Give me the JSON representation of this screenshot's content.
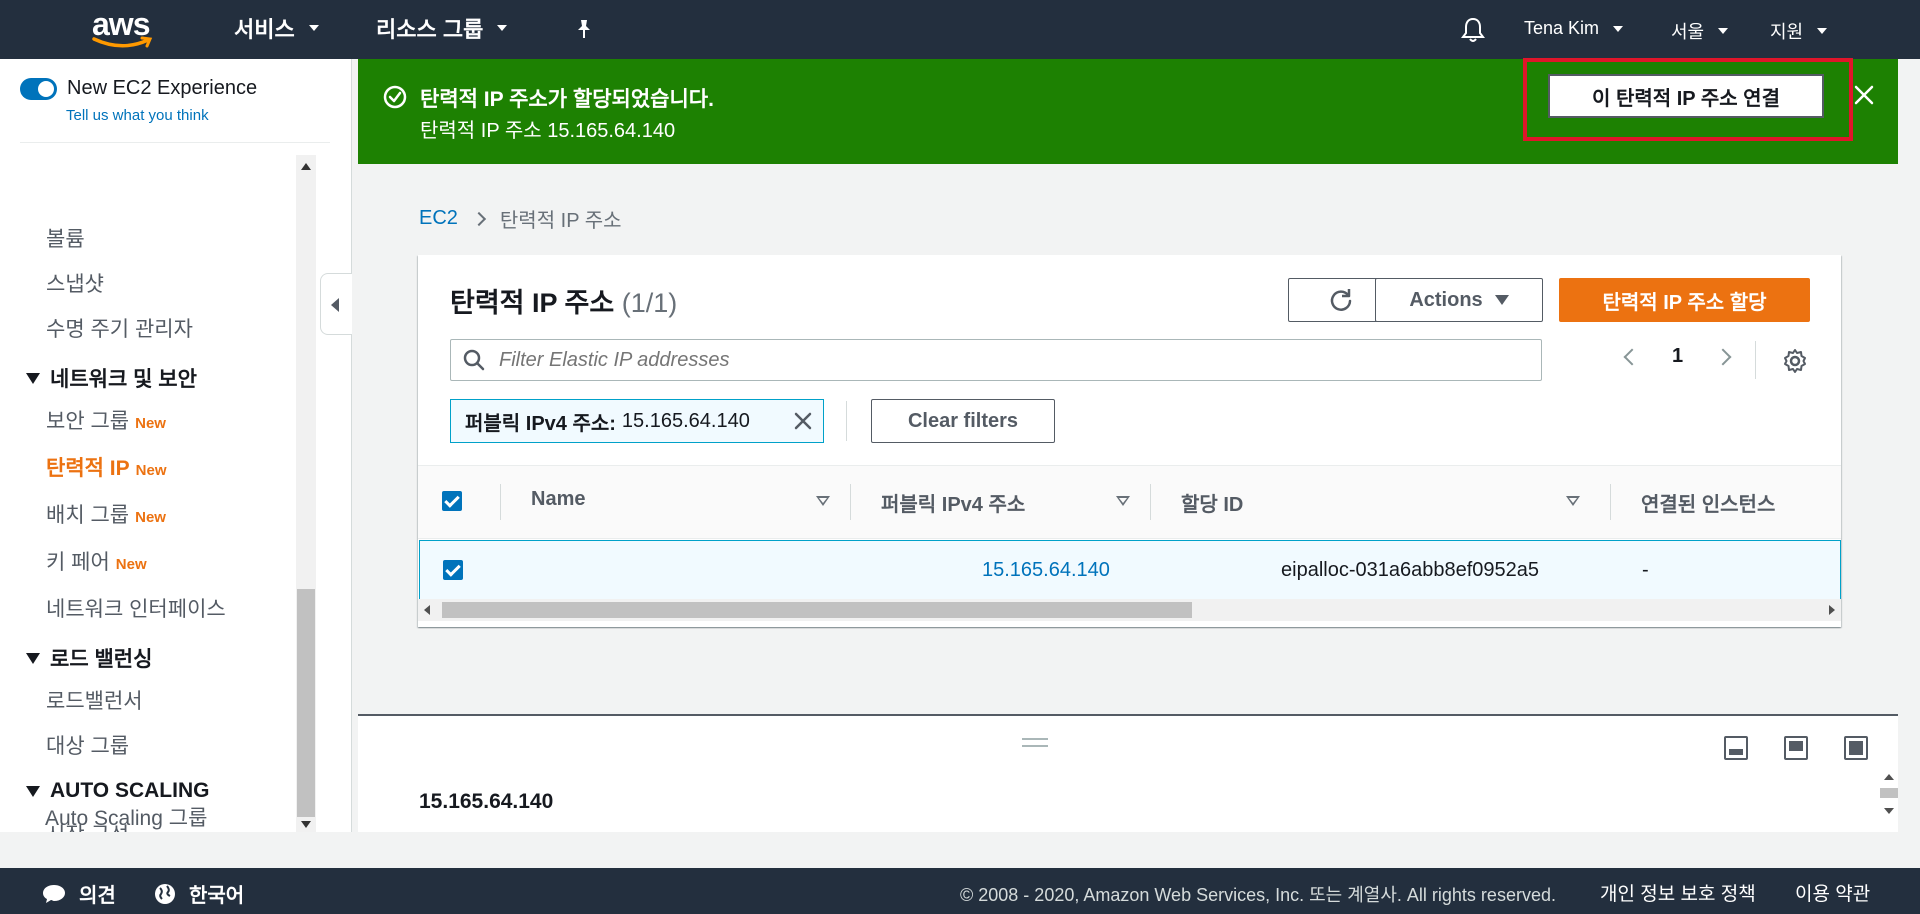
{
  "nav": {
    "logo": "aws",
    "services": "서비스",
    "resource_groups": "리소스 그룹",
    "user": "Tena Kim",
    "region": "서울",
    "support": "지원",
    "icons": [
      "bell-icon",
      "pin-icon"
    ]
  },
  "sidebar": {
    "toggle_label": "New EC2 Experience",
    "toggle_on": true,
    "feedback": "Tell us what you think",
    "new_badge": "New",
    "items": [
      {
        "type": "link",
        "label": "볼륨"
      },
      {
        "type": "link",
        "label": "스냅샷"
      },
      {
        "type": "link",
        "label": "수명 주기 관리자"
      },
      {
        "type": "section",
        "label": "네트워크 및 보안"
      },
      {
        "type": "link",
        "label": "보안 그룹",
        "new": true
      },
      {
        "type": "link",
        "label": "탄력적 IP",
        "new": true,
        "active": true
      },
      {
        "type": "link",
        "label": "배치 그룹",
        "new": true
      },
      {
        "type": "link",
        "label": "키 페어",
        "new": true
      },
      {
        "type": "link",
        "label": "네트워크 인터페이스"
      },
      {
        "type": "section",
        "label": "로드 밸런싱"
      },
      {
        "type": "link",
        "label": "로드밸런서"
      },
      {
        "type": "link",
        "label": "대상 그룹"
      },
      {
        "type": "section",
        "label": "AUTO SCALING"
      },
      {
        "type": "link",
        "label": "시작 구성"
      },
      {
        "type": "link",
        "label": "Auto Scaling 그룹"
      }
    ]
  },
  "flash": {
    "title": "탄력적 IP 주소가 할당되었습니다.",
    "message": "탄력적 IP 주소 15.165.64.140",
    "action": "이 탄력적 IP 주소 연결",
    "highlight_color": "#e0152a",
    "color": "#1d8102"
  },
  "breadcrumb": {
    "root": "EC2",
    "current": "탄력적 IP 주소"
  },
  "panel": {
    "title": "탄력적 IP 주소",
    "count": "(1/1)",
    "actions": "Actions",
    "allocate": "탄력적 IP 주소 할당",
    "search_placeholder": "Filter Elastic IP addresses",
    "page": "1",
    "filter_key": "퍼블릭 IPv4 주소:",
    "filter_value": "15.165.64.140",
    "clear_filters": "Clear filters",
    "columns": [
      "Name",
      "퍼블릭 IPv4 주소",
      "할당 ID",
      "연결된 인스턴스"
    ],
    "rows": [
      {
        "selected": true,
        "name": "",
        "ip": "15.165.64.140",
        "allocation_id": "eipalloc-031a6abb8ef0952a5",
        "instance": "-"
      }
    ]
  },
  "detail": {
    "title": "15.165.64.140"
  },
  "footer": {
    "feedback": "의견",
    "language": "한국어",
    "copyright": "© 2008 - 2020, Amazon Web Services, Inc. 또는 계열사. All rights reserved.",
    "privacy": "개인 정보 보호 정책",
    "terms": "이용 약관"
  },
  "colors": {
    "nav_bg": "#232f3e",
    "accent": "#ec7211",
    "link": "#0073bb"
  }
}
